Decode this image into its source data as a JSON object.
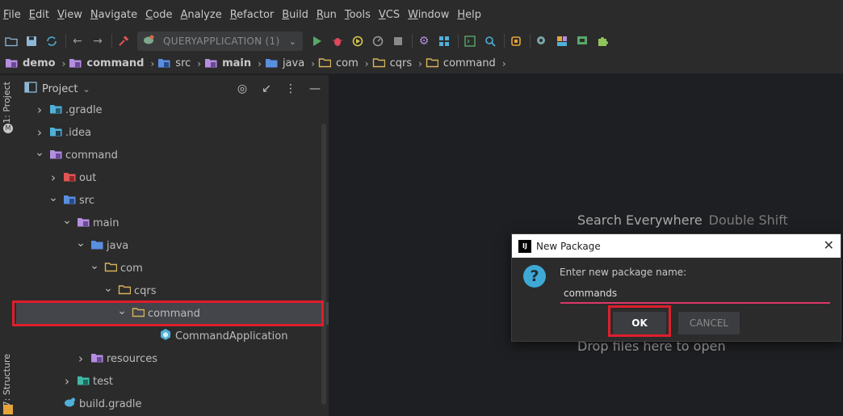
{
  "menu": [
    "File",
    "Edit",
    "View",
    "Navigate",
    "Code",
    "Analyze",
    "Refactor",
    "Build",
    "Run",
    "Tools",
    "VCS",
    "Window",
    "Help"
  ],
  "toolbar": {
    "run_config": "QUERYAPPLICATION (1)"
  },
  "breadcrumbs": [
    {
      "label": "demo",
      "bold": true,
      "kind": "module"
    },
    {
      "label": "command",
      "bold": true,
      "kind": "module"
    },
    {
      "label": "src",
      "bold": false,
      "kind": "src"
    },
    {
      "label": "main",
      "bold": true,
      "kind": "module"
    },
    {
      "label": "java",
      "bold": false,
      "kind": "java"
    },
    {
      "label": "com",
      "bold": false,
      "kind": "package"
    },
    {
      "label": "cqrs",
      "bold": false,
      "kind": "package"
    },
    {
      "label": "command",
      "bold": false,
      "kind": "package"
    }
  ],
  "side_tabs": {
    "project": "1: Project",
    "structure": "7: Structure"
  },
  "panel": {
    "title": "Project"
  },
  "tree": [
    {
      "label": ".gradle",
      "depth": 1,
      "chevron": "right",
      "icon": "gradle-folder-icon"
    },
    {
      "label": ".idea",
      "depth": 1,
      "chevron": "right",
      "icon": "idea-folder-icon"
    },
    {
      "label": "command",
      "depth": 1,
      "chevron": "down",
      "icon": "module-folder-icon"
    },
    {
      "label": "out",
      "depth": 2,
      "chevron": "right",
      "icon": "excluded-folder-icon"
    },
    {
      "label": "src",
      "depth": 2,
      "chevron": "down",
      "icon": "src-folder-icon"
    },
    {
      "label": "main",
      "depth": 3,
      "chevron": "down",
      "icon": "module-folder-icon"
    },
    {
      "label": "java",
      "depth": 4,
      "chevron": "down",
      "icon": "source-root-icon"
    },
    {
      "label": "com",
      "depth": 5,
      "chevron": "down",
      "icon": "package-icon"
    },
    {
      "label": "cqrs",
      "depth": 6,
      "chevron": "down",
      "icon": "package-icon"
    },
    {
      "label": "command",
      "depth": 7,
      "chevron": "down",
      "icon": "package-icon",
      "selected": true
    },
    {
      "label": "CommandApplication",
      "depth": 9,
      "chevron": "",
      "icon": "spring-class-icon"
    },
    {
      "label": "resources",
      "depth": 4,
      "chevron": "right",
      "icon": "resources-folder-icon"
    },
    {
      "label": "test",
      "depth": 3,
      "chevron": "right",
      "icon": "test-folder-icon"
    },
    {
      "label": "build.gradle",
      "depth": 2,
      "chevron": "",
      "icon": "gradle-file-icon"
    }
  ],
  "editor": {
    "search_hint": "Search Everywhere",
    "search_key": "Double Shift",
    "drop_hint": "Drop files here to open"
  },
  "dialog": {
    "title": "New Package",
    "prompt": "Enter new package name:",
    "value": "commands",
    "ok": "OK",
    "cancel": "CANCEL"
  },
  "colors": {
    "highlight": "#e01e2b",
    "input_underline": "#e0356a",
    "accent_blue": "#3fa9d6"
  }
}
